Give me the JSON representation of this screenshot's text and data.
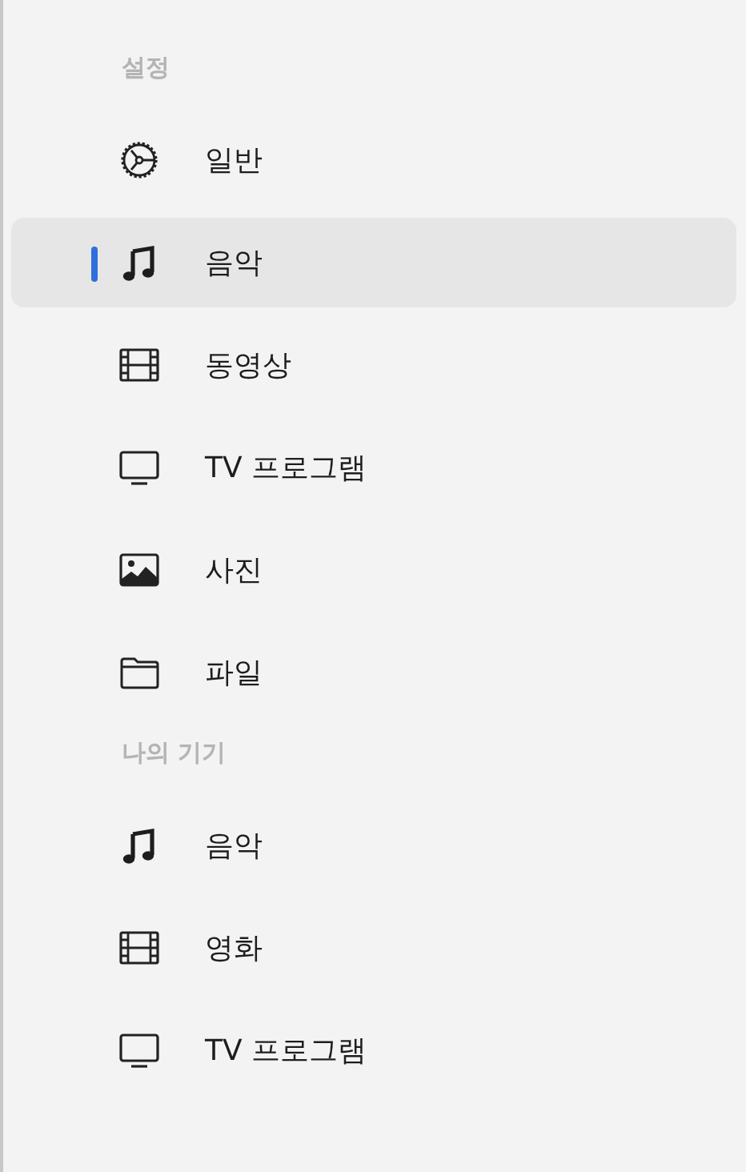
{
  "sections": [
    {
      "title": "설정",
      "items": [
        {
          "label": "일반",
          "kind": "gear",
          "selected": false
        },
        {
          "label": "음악",
          "kind": "music",
          "selected": true
        },
        {
          "label": "동영상",
          "kind": "film",
          "selected": false
        },
        {
          "label": "TV 프로그램",
          "kind": "tv",
          "selected": false
        },
        {
          "label": "사진",
          "kind": "photo",
          "selected": false
        },
        {
          "label": "파일",
          "kind": "folder",
          "selected": false
        }
      ]
    },
    {
      "title": "나의 기기",
      "items": [
        {
          "label": "음악",
          "kind": "music",
          "selected": false
        },
        {
          "label": "영화",
          "kind": "film",
          "selected": false
        },
        {
          "label": "TV 프로그램",
          "kind": "tv",
          "selected": false
        }
      ]
    }
  ]
}
